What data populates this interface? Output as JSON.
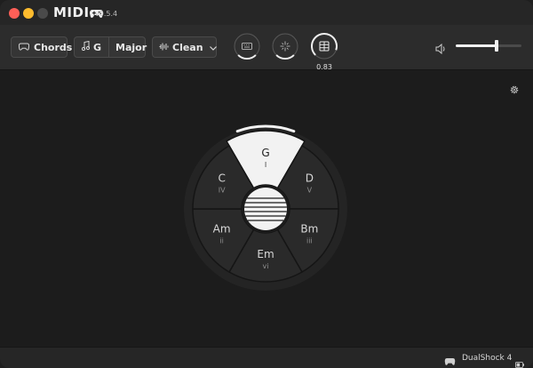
{
  "app": {
    "title": "MIDI",
    "version": "v0.5.4"
  },
  "toolbar": {
    "mode_label": "Chords",
    "key_note": "G",
    "key_scale": "Major",
    "sound_label": "Clean",
    "knob_value": "0.83",
    "volume_fraction": 0.62
  },
  "wheel": {
    "segments": [
      {
        "chord": "G",
        "degree": "I",
        "selected": true
      },
      {
        "chord": "D",
        "degree": "V",
        "selected": false
      },
      {
        "chord": "Bm",
        "degree": "iii",
        "selected": false
      },
      {
        "chord": "Em",
        "degree": "vi",
        "selected": false
      },
      {
        "chord": "Am",
        "degree": "ii",
        "selected": false
      },
      {
        "chord": "C",
        "degree": "IV",
        "selected": false
      }
    ]
  },
  "status": {
    "controller": "DualShock 4"
  },
  "colors": {
    "accent": "#f2f2f2",
    "wheel_fill": "#2a2a2a",
    "ring": "#242424"
  }
}
